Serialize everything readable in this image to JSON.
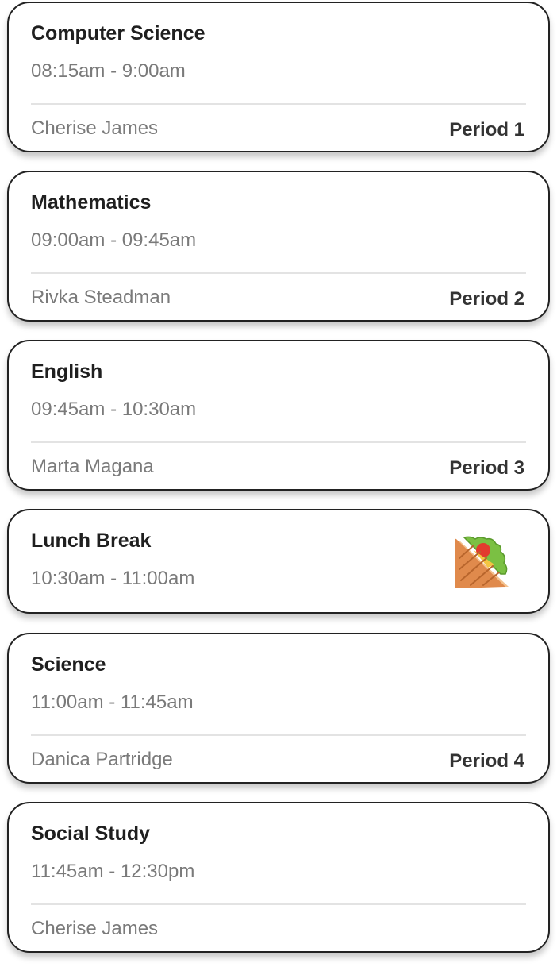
{
  "schedule": [
    {
      "subject": "Computer Science",
      "time": "08:15am - 9:00am",
      "teacher": "Cherise James",
      "period": "Period 1"
    },
    {
      "subject": "Mathematics",
      "time": "09:00am - 09:45am",
      "teacher": "Rivka Steadman",
      "period": "Period 2"
    },
    {
      "subject": "English",
      "time": "09:45am - 10:30am",
      "teacher": "Marta Magana",
      "period": "Period 3"
    },
    {
      "subject": "Lunch Break",
      "time": "10:30am - 11:00am",
      "icon": "sandwich-icon"
    },
    {
      "subject": "Science",
      "time": "11:00am - 11:45am",
      "teacher": "Danica Partridge",
      "period": "Period 4"
    },
    {
      "subject": "Social Study",
      "time": "11:45am - 12:30pm",
      "teacher": "Cherise James"
    }
  ],
  "colors": {
    "card_border": "#222222",
    "title_text": "#1f1f1f",
    "secondary_text": "#7a7a7a",
    "divider": "#e3e3e3",
    "sandwich_bread": "#e08a4c",
    "sandwich_lettuce": "#7bc043",
    "sandwich_tomato": "#e23b2e"
  }
}
